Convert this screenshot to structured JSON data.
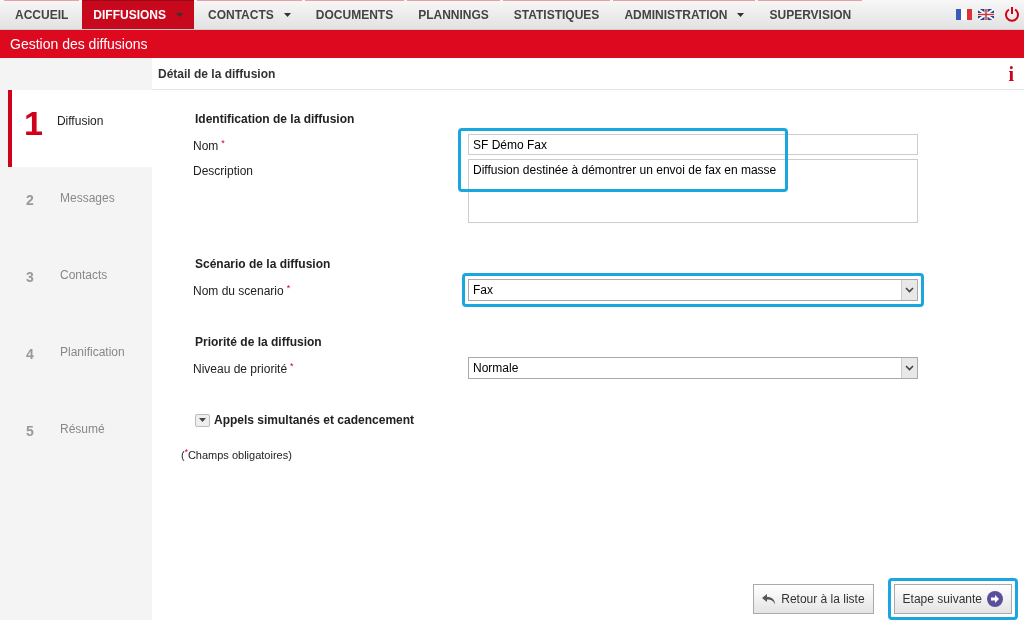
{
  "nav": [
    {
      "label": "ACCUEIL",
      "selected": false,
      "dropdown": false
    },
    {
      "label": "DIFFUSIONS",
      "selected": true,
      "dropdown": true
    },
    {
      "label": "CONTACTS",
      "selected": false,
      "dropdown": true
    },
    {
      "label": "DOCUMENTS",
      "selected": false,
      "dropdown": false
    },
    {
      "label": "PLANNINGS",
      "selected": false,
      "dropdown": false
    },
    {
      "label": "STATISTIQUES",
      "selected": false,
      "dropdown": false
    },
    {
      "label": "ADMINISTRATION",
      "selected": false,
      "dropdown": true
    },
    {
      "label": "SUPERVISION",
      "selected": false,
      "dropdown": false
    }
  ],
  "page_title": "Gestion des diffusions",
  "panel_title": "Détail de la diffusion",
  "info_mark": "i",
  "steps": [
    {
      "number": "1",
      "label": "Diffusion",
      "selected": true
    },
    {
      "number": "2",
      "label": "Messages",
      "selected": false
    },
    {
      "number": "3",
      "label": "Contacts",
      "selected": false
    },
    {
      "number": "4",
      "label": "Planification",
      "selected": false
    },
    {
      "number": "5",
      "label": "Résumé",
      "selected": false
    }
  ],
  "sections": [
    {
      "title": "Identification de la diffusion",
      "fields": [
        {
          "kind": "text",
          "label": "Nom",
          "required_mark": "*",
          "value": "SF Démo Fax"
        },
        {
          "kind": "textarea",
          "label": "Description",
          "value": "Diffusion destinée à démontrer un envoi de fax en masse"
        }
      ]
    },
    {
      "title": "Scénario de la diffusion",
      "fields": [
        {
          "kind": "select",
          "label": "Nom du scenario",
          "required_mark": "*",
          "value": "Fax",
          "highlighted": true
        }
      ]
    },
    {
      "title": "Priorité de la diffusion",
      "fields": [
        {
          "kind": "select",
          "label": "Niveau de priorité",
          "required_mark": "*",
          "value": "Normale",
          "highlighted": false
        }
      ]
    }
  ],
  "collapsible": {
    "label": "Appels simultanés et cadencement",
    "expanded": false
  },
  "required_note": "($^{*}$Champs obligatoires)",
  "buttons": [
    {
      "label": "Retour à la liste",
      "kind": "back",
      "highlighted": false
    },
    {
      "label": "Etape suivante",
      "kind": "next",
      "highlighted": true
    }
  ]
}
